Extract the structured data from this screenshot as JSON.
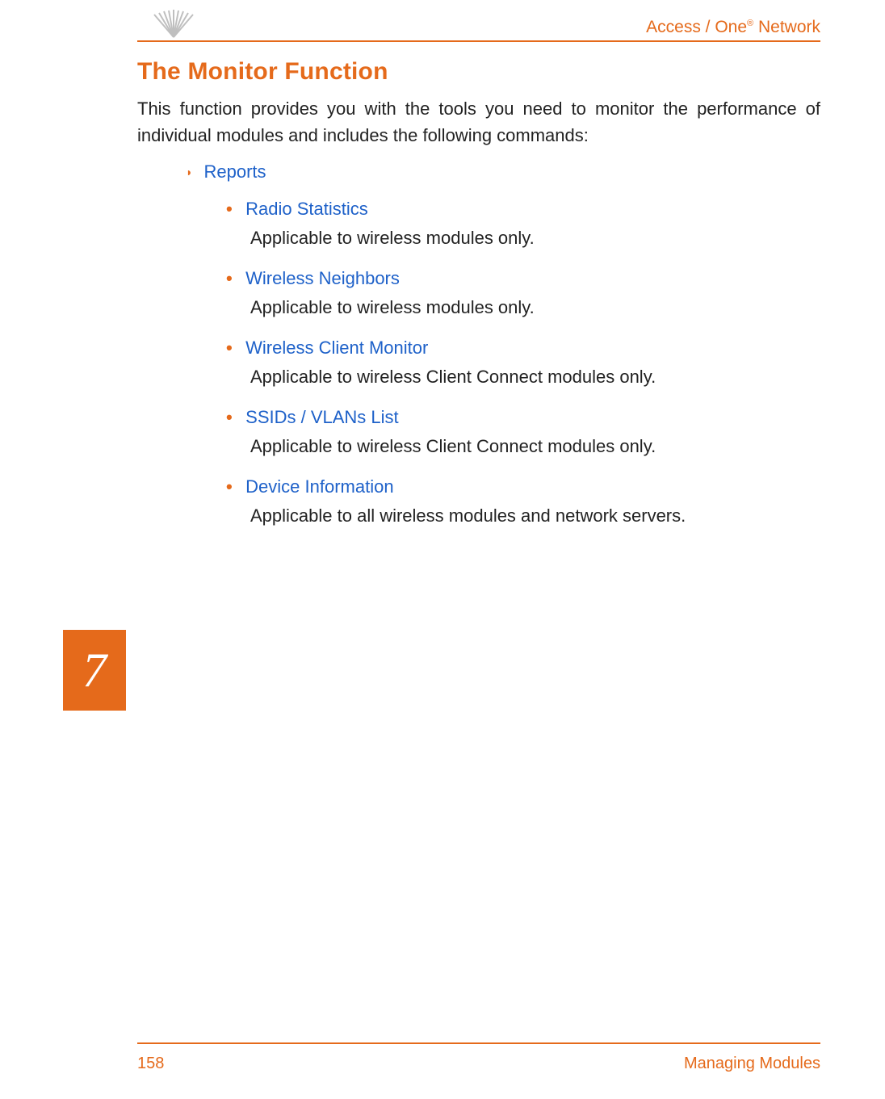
{
  "header": {
    "brand_prefix": "Access / One",
    "brand_suffix": " Network",
    "reg": "®"
  },
  "title": "The Monitor Function",
  "intro": "This function provides you with the tools you need to monitor the performance of individual modules and includes the following commands:",
  "list": {
    "top": "Reports",
    "items": [
      {
        "link": "Radio Statistics",
        "note": "Applicable to wireless modules only."
      },
      {
        "link": "Wireless Neighbors",
        "note": "Applicable to wireless modules only."
      },
      {
        "link": "Wireless Client Monitor",
        "note": "Applicable to wireless Client Connect modules only."
      },
      {
        "link": "SSIDs / VLANs List",
        "note": "Applicable to wireless Client Connect modules only."
      },
      {
        "link": "Device Information",
        "note": "Applicable to all wireless modules and network servers."
      }
    ]
  },
  "tab": "7",
  "footer": {
    "page": "158",
    "chapter": "Managing Modules"
  }
}
